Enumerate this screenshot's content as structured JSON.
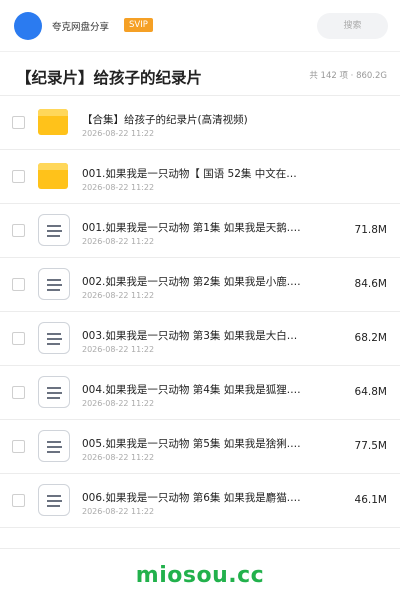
{
  "header": {
    "brand": "夸克网盘分享",
    "badge": "SVIP",
    "search_label": "搜索"
  },
  "share": {
    "title": "【纪录片】给孩子的纪录片",
    "stats": "共 142 项 · 860.2G"
  },
  "files": [
    {
      "type": "folder",
      "name": "【合集】给孩子的纪录片(高清视频)",
      "date": "2026-08-22 11:22",
      "size": ""
    },
    {
      "type": "folder",
      "name": "001.如果我是一只动物【 国语  52集 中文在…",
      "date": "2026-08-22 11:22",
      "size": ""
    },
    {
      "type": "file",
      "name": "001.如果我是一只动物 第1集 如果我是天鹅.m…",
      "date": "2026-08-22 11:22",
      "size": "71.8M"
    },
    {
      "type": "file",
      "name": "002.如果我是一只动物 第2集 如果我是小鹿.m…",
      "date": "2026-08-22 11:22",
      "size": "84.6M"
    },
    {
      "type": "file",
      "name": "003.如果我是一只动物 第3集 如果我是大白熊犬…",
      "date": "2026-08-22 11:22",
      "size": "68.2M"
    },
    {
      "type": "file",
      "name": "004.如果我是一只动物 第4集 如果我是狐狸.m…",
      "date": "2026-08-22 11:22",
      "size": "64.8M"
    },
    {
      "type": "file",
      "name": "005.如果我是一只动物 第5集 如果我是猞猁.m…",
      "date": "2026-08-22 11:22",
      "size": "77.5M"
    },
    {
      "type": "file",
      "name": "006.如果我是一只动物 第6集 如果我是麝猫.m…",
      "date": "2026-08-22 11:22",
      "size": "46.1M"
    }
  ],
  "watermark": "miosou.cc"
}
